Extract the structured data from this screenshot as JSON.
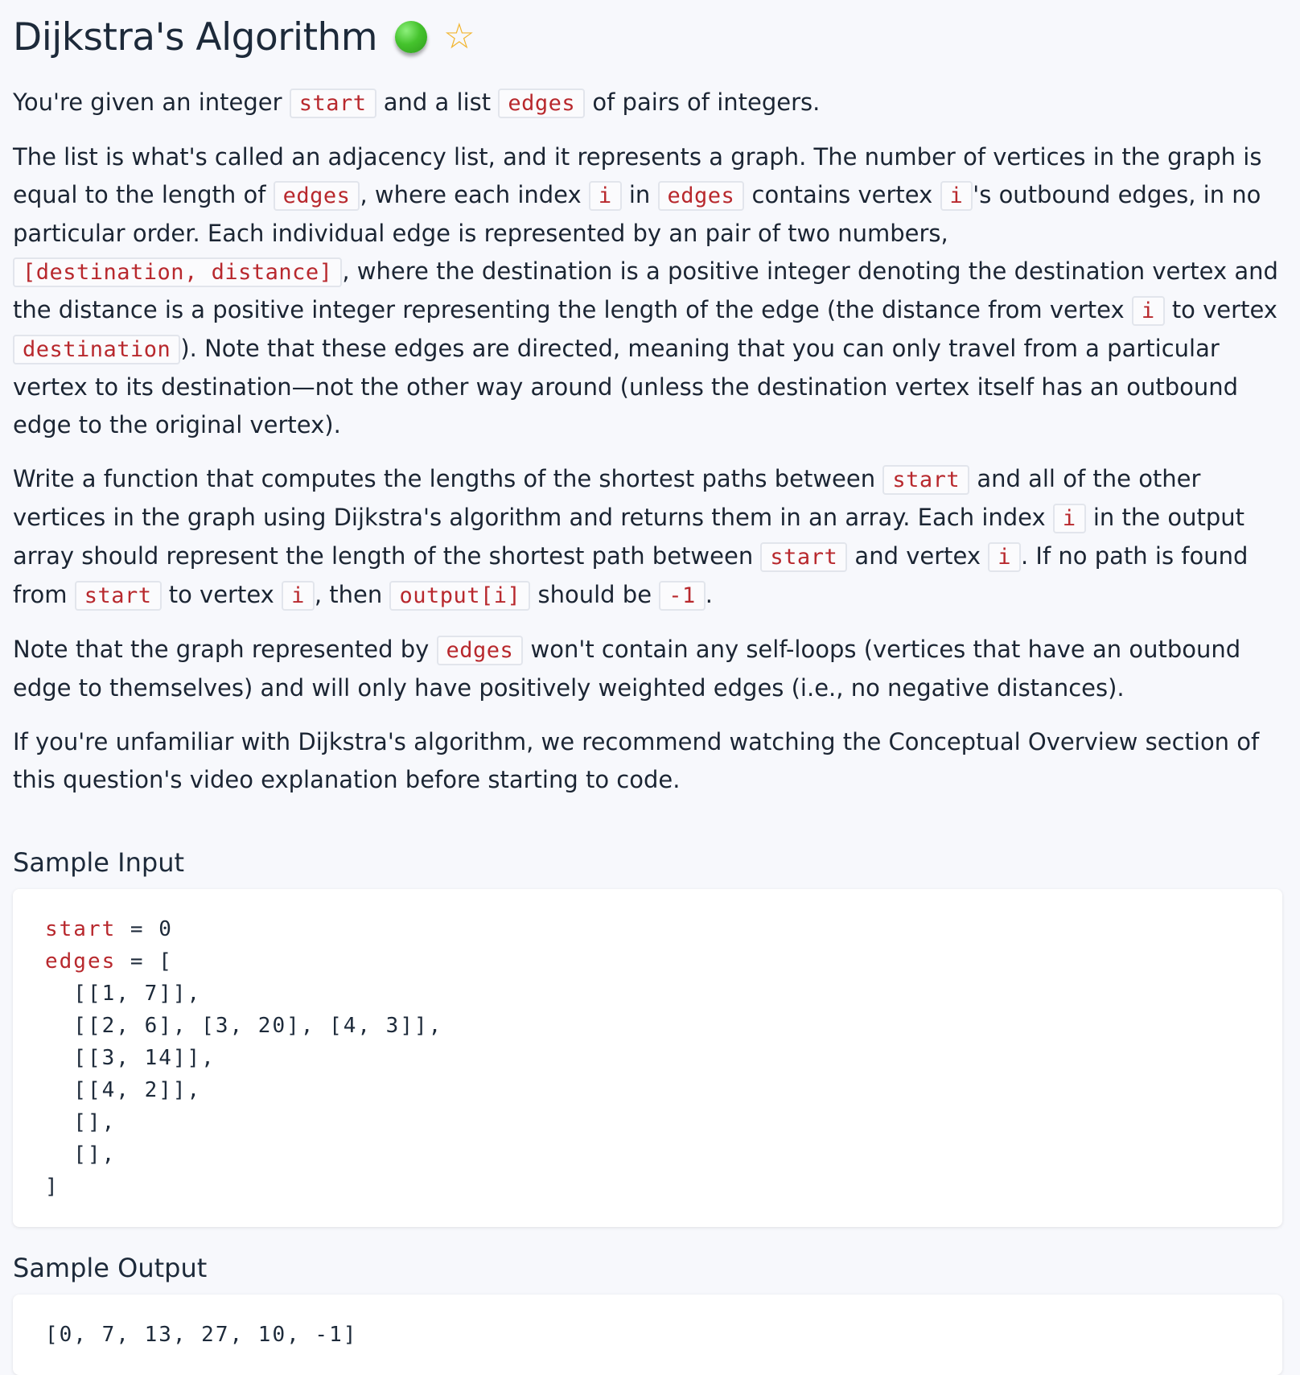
{
  "title": "Dijkstra's Algorithm",
  "status": "completed",
  "star_icon": "star-outline-icon",
  "colors": {
    "accent_code": "#b8282d",
    "status_green": "#45c32d",
    "star": "#f2b632"
  },
  "p1": {
    "t1": "You're given an integer",
    "c1": "start",
    "t2": "and a list",
    "c2": "edges",
    "t3": "of pairs of integers."
  },
  "p2": {
    "t1": "The list is what's called an adjacency list, and it represents a graph. The number of vertices in the graph is equal to the length of",
    "c1": "edges",
    "t2": ", where each index",
    "c2": "i",
    "t3": "in",
    "c3": "edges",
    "t4": "contains vertex",
    "c4": "i",
    "t5": "'s outbound edges, in no particular order. Each individual edge is represented by an pair of two numbers,",
    "c5": "[destination, distance]",
    "t6": ", where the destination is a positive integer denoting the destination vertex and the distance is a positive integer representing the length of the edge (the distance from vertex",
    "c6": "i",
    "t7": "to vertex",
    "c7": "destination",
    "t8": "). Note that these edges are directed, meaning that you can only travel from a particular vertex to its destination—not the other way around (unless the destination vertex itself has an outbound edge to the original vertex)."
  },
  "p3": {
    "t1": "Write a function that computes the lengths of the shortest paths between",
    "c1": "start",
    "t2": "and all of the other vertices in the graph using Dijkstra's algorithm and returns them in an array. Each index",
    "c2": "i",
    "t3": "in the output array should represent the length of the shortest path between",
    "c3": "start",
    "t4": "and vertex",
    "c4": "i",
    "t5": ". If no path is found from",
    "c5": "start",
    "t6": "to vertex",
    "c6": "i",
    "t7": ", then",
    "c7": "output[i]",
    "t8": "should be",
    "c8": "-1",
    "t9": "."
  },
  "p4": {
    "t1": "Note that the graph represented by",
    "c1": "edges",
    "t2": "won't contain any self-loops (vertices that have an outbound edge to themselves) and will only have positively weighted edges (i.e., no negative distances)."
  },
  "p5": {
    "t1": "If you're unfamiliar with Dijkstra's algorithm, we recommend watching the Conceptual Overview section of this question's video explanation before starting to code."
  },
  "sample_input": {
    "heading": "Sample Input",
    "line1_var": "start",
    "line1_rest": " = 0",
    "line2_var": "edges",
    "line2_rest": " = [",
    "lines": [
      "  [[1, 7]],",
      "  [[2, 6], [3, 20], [4, 3]],",
      "  [[3, 14]],",
      "  [[4, 2]],",
      "  [],",
      "  [],",
      "]"
    ]
  },
  "sample_output": {
    "heading": "Sample Output",
    "value": "[0, 7, 13, 27, 10, -1]"
  }
}
